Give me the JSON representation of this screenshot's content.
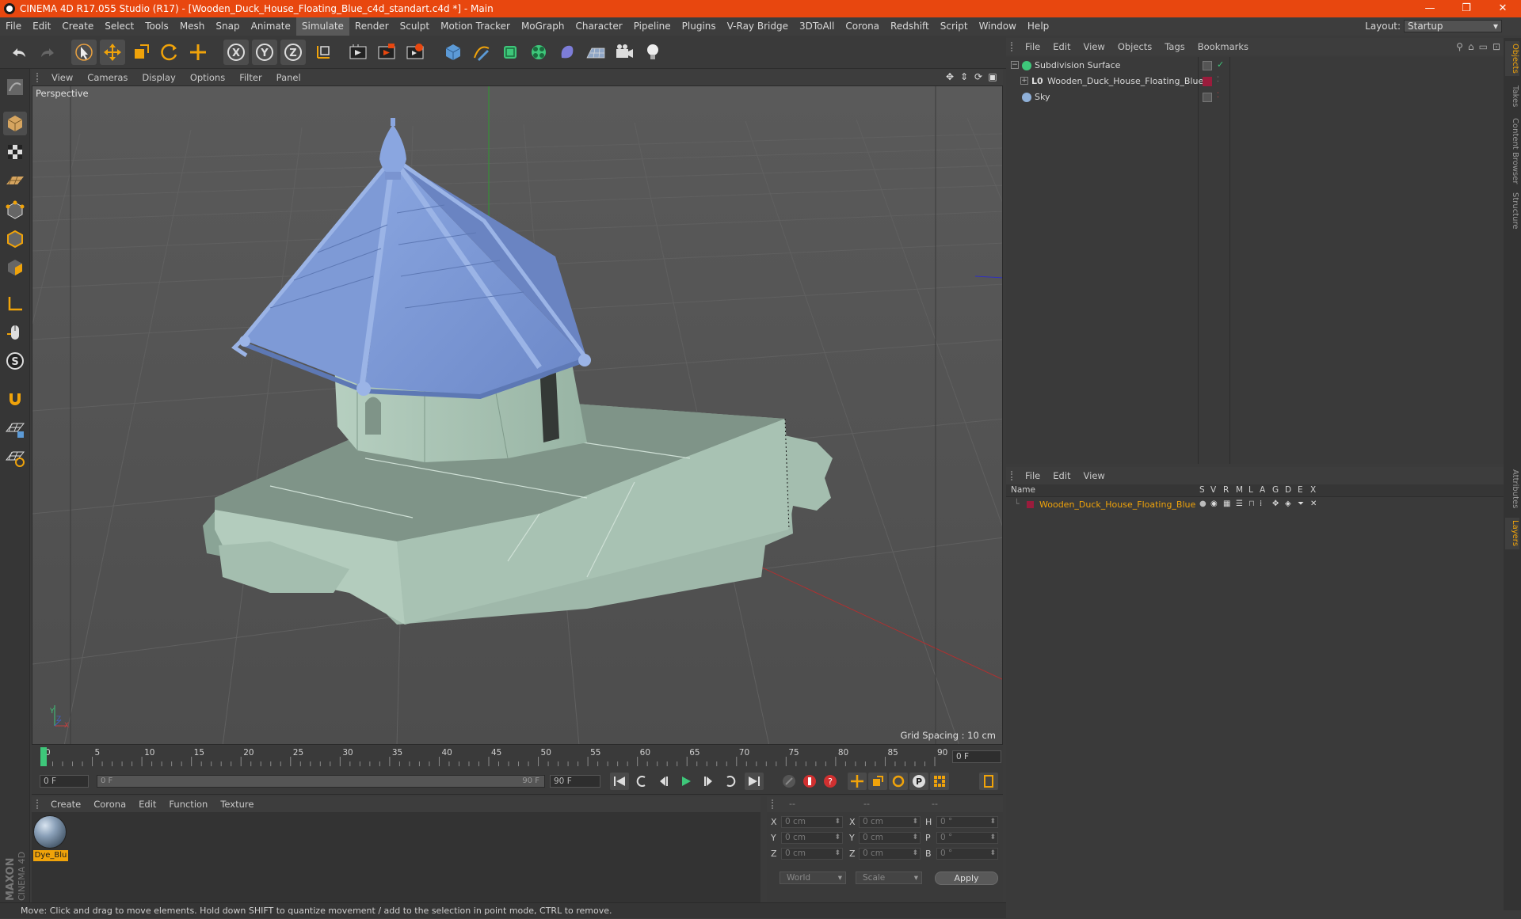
{
  "window": {
    "title": "CINEMA 4D R17.055 Studio (R17) - [Wooden_Duck_House_Floating_Blue_c4d_standart.c4d *] - Main",
    "buttons": {
      "minimize": "—",
      "restore": "❐",
      "close": "✕"
    }
  },
  "menubar": {
    "items": [
      "File",
      "Edit",
      "Create",
      "Select",
      "Tools",
      "Mesh",
      "Snap",
      "Animate",
      "Simulate",
      "Render",
      "Sculpt",
      "Motion Tracker",
      "MoGraph",
      "Character",
      "Pipeline",
      "Plugins",
      "V-Ray Bridge",
      "3DToAll",
      "Corona",
      "Redshift",
      "Script",
      "Window",
      "Help"
    ],
    "active": "Simulate",
    "layout_label": "Layout:",
    "layout_value": "Startup"
  },
  "viewport": {
    "menu": [
      "View",
      "Cameras",
      "Display",
      "Options",
      "Filter",
      "Panel"
    ],
    "label": "Perspective",
    "grid_spacing": "Grid Spacing : 10 cm",
    "axis": {
      "y": "Y",
      "x": "X",
      "z": "Z"
    }
  },
  "timeline": {
    "ticks": [
      "0",
      "5",
      "10",
      "15",
      "20",
      "25",
      "30",
      "35",
      "40",
      "45",
      "50",
      "55",
      "60",
      "65",
      "70",
      "75",
      "80",
      "85",
      "90"
    ],
    "current_frame": "0 F"
  },
  "transport": {
    "start": "0 F",
    "range_start": "0 F",
    "range_end": "90 F",
    "end": "90 F"
  },
  "material_manager": {
    "menu": [
      "Create",
      "Corona",
      "Edit",
      "Function",
      "Texture"
    ],
    "materials": [
      {
        "name": "Dye_Blu"
      }
    ]
  },
  "coordinates": {
    "header": [
      "--",
      "--",
      "--"
    ],
    "rows": [
      {
        "a": "X",
        "av": "0 cm",
        "b": "X",
        "bv": "0 cm",
        "c": "H",
        "cv": "0 °"
      },
      {
        "a": "Y",
        "av": "0 cm",
        "b": "Y",
        "bv": "0 cm",
        "c": "P",
        "cv": "0 °"
      },
      {
        "a": "Z",
        "av": "0 cm",
        "b": "Z",
        "bv": "0 cm",
        "c": "B",
        "cv": "0 °"
      }
    ],
    "space": "World",
    "mode": "Scale",
    "apply": "Apply"
  },
  "object_manager": {
    "menu": [
      "File",
      "Edit",
      "View",
      "Objects",
      "Tags",
      "Bookmarks"
    ],
    "objects": [
      {
        "name": "Subdivision Surface",
        "color": "#3ec77a"
      },
      {
        "name": "Wooden_Duck_House_Floating_Blue",
        "color": "#9a1c3c"
      },
      {
        "name": "Sky",
        "color": "#8fb0d8"
      }
    ]
  },
  "layer_manager": {
    "menu": [
      "File",
      "Edit",
      "View"
    ],
    "columns": [
      "Name",
      "S",
      "V",
      "R",
      "M",
      "L",
      "A",
      "G",
      "D",
      "E",
      "X"
    ],
    "layers": [
      {
        "name": "Wooden_Duck_House_Floating_Blue",
        "color": "#9a1c3c"
      }
    ]
  },
  "right_tabs": [
    "Objects",
    "Takes",
    "Content Browser",
    "Structure",
    "Attributes",
    "Layers"
  ],
  "status": "Move: Click and drag to move elements. Hold down SHIFT to quantize movement / add to the selection in point mode, CTRL to remove.",
  "branding": "MAXON CINEMA 4D",
  "colors": {
    "accent": "#e8470f",
    "highlight": "#f0a30a",
    "roof": "#7d9bd6",
    "walls": "#a9c4b4"
  }
}
